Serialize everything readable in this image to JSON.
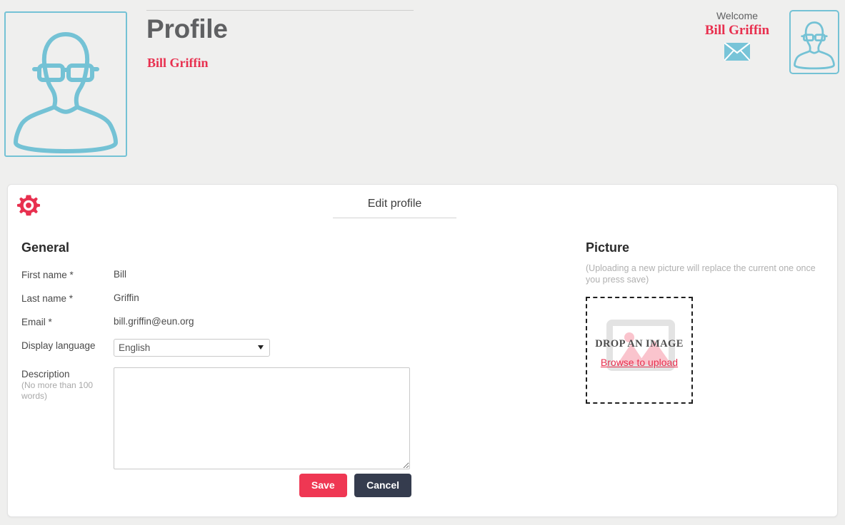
{
  "header": {
    "title": "Profile",
    "subtitle": "Bill Griffin",
    "avatar_icon": "user-avatar-glasses-icon",
    "welcome_label": "Welcome",
    "welcome_name": "Bill Griffin",
    "mail_icon": "envelope-icon",
    "user_avatar_icon": "user-avatar-glasses-icon"
  },
  "card": {
    "gear_icon": "gear-icon",
    "tab_label": "Edit profile"
  },
  "general": {
    "heading": "General",
    "fields": [
      {
        "label": "First name *",
        "value": "Bill"
      },
      {
        "label": "Last name *",
        "value": "Griffin"
      },
      {
        "label": "Email *",
        "value": "bill.griffin@eun.org"
      }
    ],
    "language": {
      "label": "Display language",
      "selected": "English",
      "options": [
        "English"
      ]
    },
    "description": {
      "label": "Description",
      "hint": "(No more than 100 words)",
      "value": "",
      "placeholder": ""
    }
  },
  "actions": {
    "save_label": "Save",
    "cancel_label": "Cancel"
  },
  "picture": {
    "heading": "Picture",
    "note": "(Uploading a new picture will replace the current one once you press save)",
    "dropzone_text": "DROP AN IMAGE",
    "dropzone_link": "Browse to upload",
    "watermark_icon": "image-placeholder-icon"
  },
  "colors": {
    "page_background": "#efefee",
    "card_background": "#ffffff",
    "accent_red": "#e8304f",
    "save_button": "#ef3753",
    "cancel_button": "#353c4e",
    "avatar_blue": "#74c2d5",
    "title_gray": "#5f6062"
  }
}
